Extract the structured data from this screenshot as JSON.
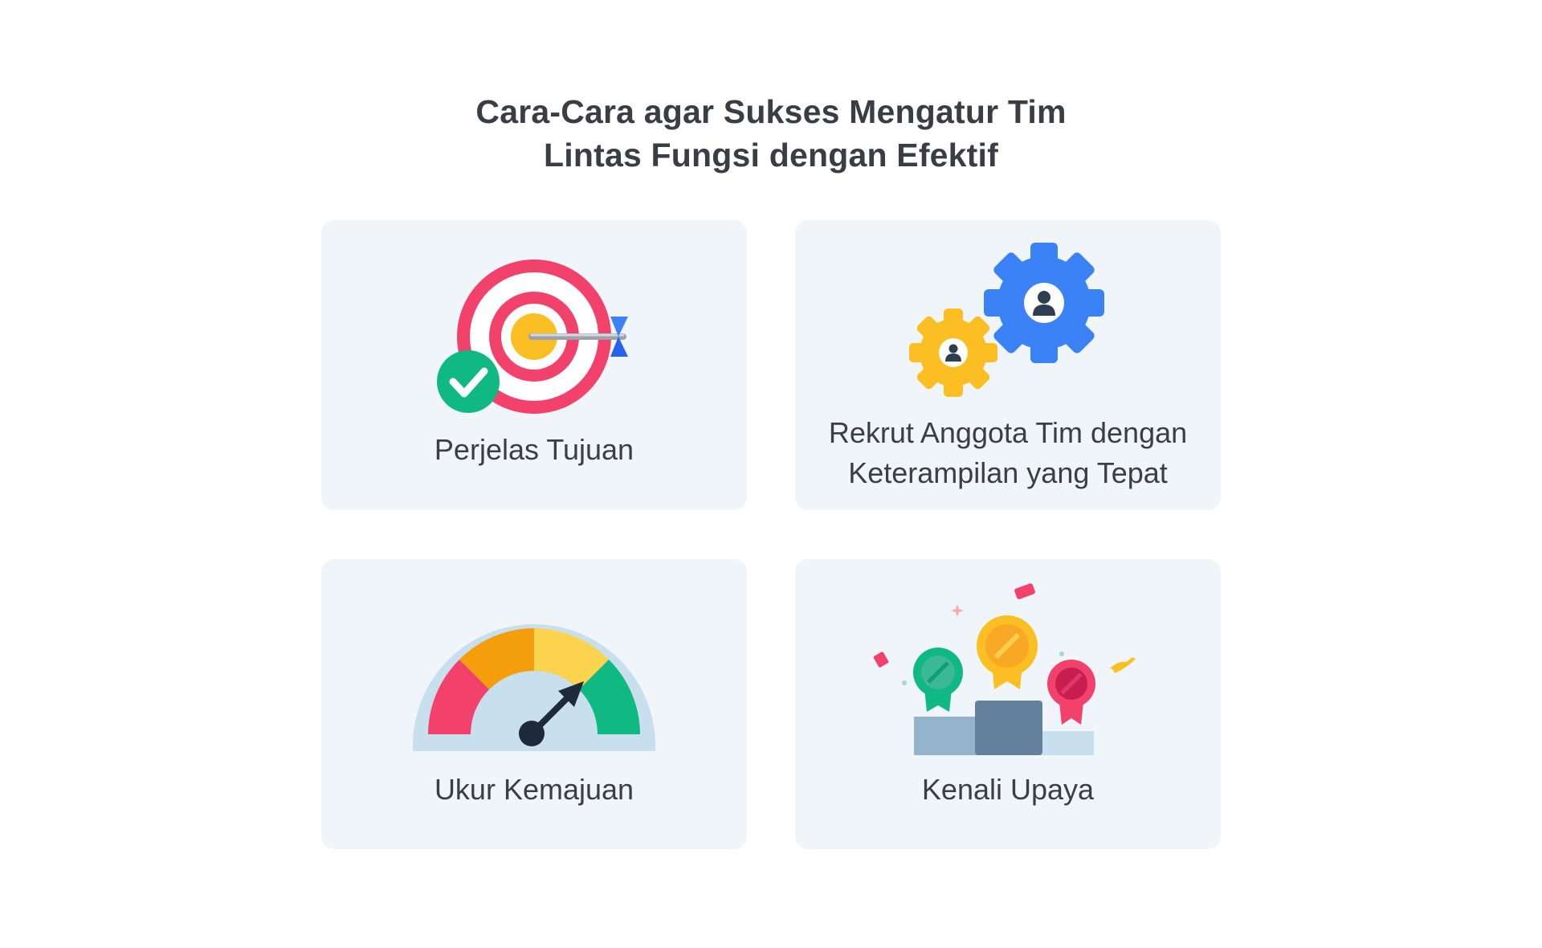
{
  "title": {
    "line1": "Cara-Cara agar Sukses Mengatur Tim",
    "line2": "Lintas Fungsi dengan Efektif"
  },
  "cards": [
    {
      "icon": "target-check-icon",
      "label": [
        "Perjelas Tujuan"
      ]
    },
    {
      "icon": "gears-people-icon",
      "label": [
        "Rekrut Anggota Tim dengan",
        "Keterampilan yang Tepat"
      ]
    },
    {
      "icon": "gauge-icon",
      "label": [
        "Ukur Kemajuan"
      ]
    },
    {
      "icon": "podium-medals-icon",
      "label": [
        "Kenali Upaya"
      ]
    }
  ],
  "colors": {
    "card_bg": "#eff5f9",
    "text": "#3b3e45",
    "red": "#f2416a",
    "yellow": "#fbbf24",
    "green": "#10b981",
    "blue": "#3b82f6",
    "orange": "#f59e0b"
  }
}
